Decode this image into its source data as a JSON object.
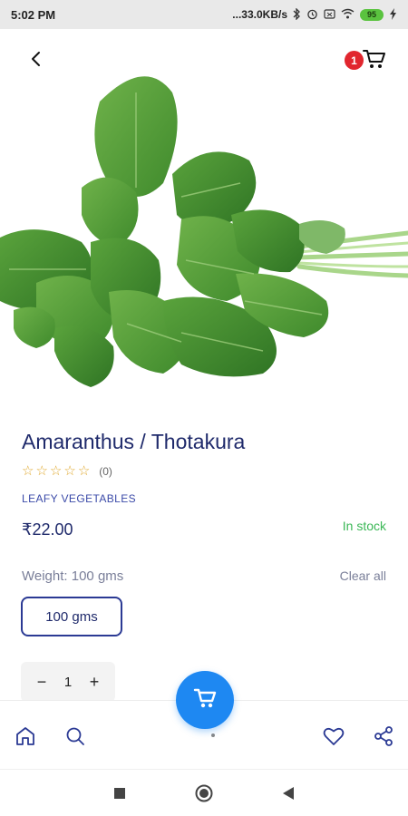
{
  "status_bar": {
    "time": "5:02 PM",
    "network_speed": "...33.0KB/s",
    "battery_level": "95",
    "icons": [
      "bluetooth-icon",
      "alarm-icon",
      "sim-icon",
      "wifi-icon",
      "battery-icon",
      "charging-icon"
    ]
  },
  "header": {
    "back_icon": "chevron-left-icon",
    "cart_icon": "cart-icon",
    "cart_count": "1"
  },
  "product": {
    "image": "amaranthus-leaves",
    "title": "Amaranthus / Thotakura",
    "rating_stars": 0,
    "rating_count": "(0)",
    "category": "LEAFY VEGETABLES",
    "price": "₹22.00",
    "stock_status": "In stock",
    "weight_label": "Weight: 100 gms",
    "clear_label": "Clear all",
    "options": [
      "100 gms"
    ],
    "quantity": "1",
    "minus_label": "−",
    "plus_label": "+"
  },
  "bottom_nav": {
    "items": [
      "home-icon",
      "search-icon",
      "add-to-cart-fab",
      "heart-icon",
      "share-icon"
    ]
  },
  "colors": {
    "title": "#1f2a6b",
    "accent_blue": "#1e88f2",
    "stock_green": "#3cb857",
    "star": "#e0a82e",
    "badge_red": "#e1262e"
  }
}
